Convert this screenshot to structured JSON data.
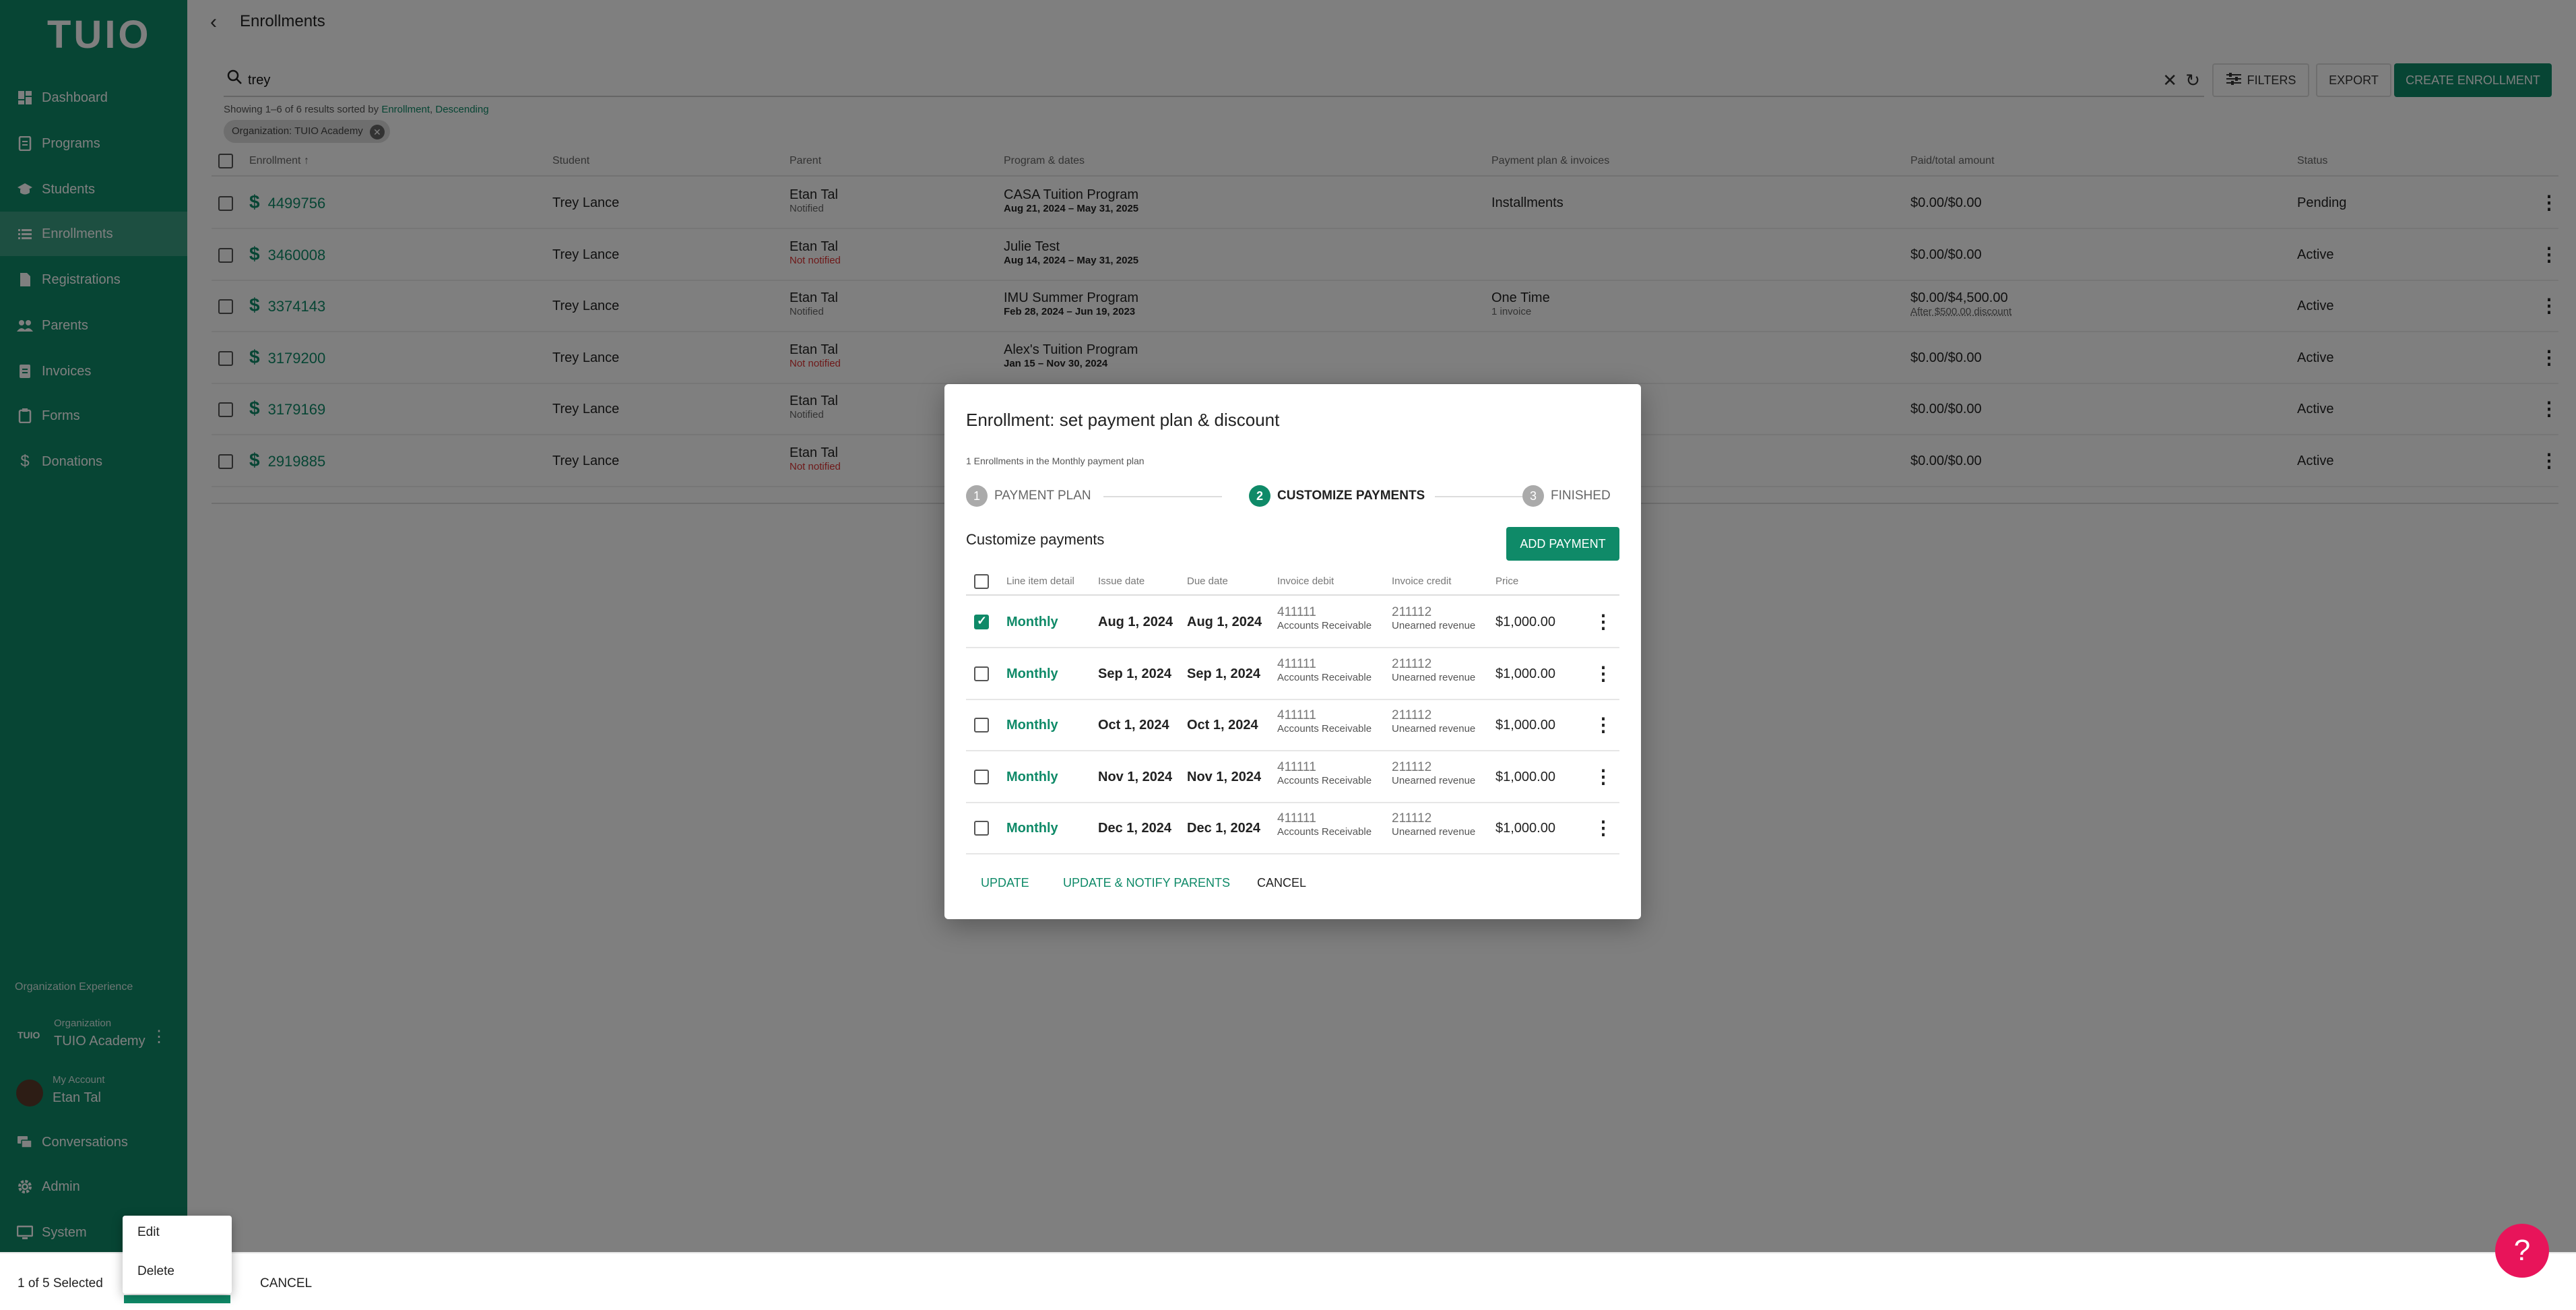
{
  "app": {
    "logo": "TUIO"
  },
  "sidebar": {
    "items": [
      {
        "label": "Dashboard",
        "icon": "dashboard-icon"
      },
      {
        "label": "Programs",
        "icon": "programs-icon"
      },
      {
        "label": "Students",
        "icon": "students-icon"
      },
      {
        "label": "Enrollments",
        "icon": "list-icon",
        "active": true
      },
      {
        "label": "Registrations",
        "icon": "registrations-icon"
      },
      {
        "label": "Parents",
        "icon": "parents-icon"
      },
      {
        "label": "Invoices",
        "icon": "invoices-icon"
      },
      {
        "label": "Forms",
        "icon": "forms-icon"
      },
      {
        "label": "Donations",
        "icon": "dollar-icon"
      }
    ],
    "org_experience": "Organization Experience",
    "org_logo": "TUIO",
    "org_caption": "Organization",
    "org_name": "TUIO Academy",
    "account_caption": "My Account",
    "account_name": "Etan Tal",
    "bottom_items": [
      {
        "label": "Conversations",
        "icon": "chat-icon"
      },
      {
        "label": "Admin",
        "icon": "gear-icon"
      },
      {
        "label": "System",
        "icon": "monitor-icon"
      }
    ]
  },
  "header": {
    "title": "Enrollments"
  },
  "search": {
    "value": "trey"
  },
  "toolbar": {
    "filters_label": "FILTERS",
    "export_label": "EXPORT",
    "create_label": "CREATE ENROLLMENT"
  },
  "results": {
    "showing_prefix": "Showing 1–6 of 6 results sorted by ",
    "sort_field": "Enrollment",
    "sort_sep": ", ",
    "sort_dir": "Descending"
  },
  "filter_chip": "Organization: TUIO Academy",
  "table": {
    "headers": [
      "Enrollment",
      "Student",
      "Parent",
      "Program & dates",
      "Payment plan & invoices",
      "Paid/total amount",
      "Status"
    ],
    "sort_arrow": "↑",
    "rows": [
      {
        "id": "4499756",
        "student": "Trey Lance",
        "parent": "Etan Tal",
        "parent_status": "Notified",
        "parent_red": false,
        "program": "CASA Tuition Program",
        "dates": "Aug 21, 2024 – May 31, 2025",
        "plan": "Installments",
        "plan_sub": "",
        "amount": "$0.00/$0.00",
        "amount_sub": "",
        "status": "Pending"
      },
      {
        "id": "3460008",
        "student": "Trey Lance",
        "parent": "Etan Tal",
        "parent_status": "Not notified",
        "parent_red": true,
        "program": "Julie Test",
        "dates": "Aug 14, 2024 – May 31, 2025",
        "plan": "",
        "plan_sub": "",
        "amount": "$0.00/$0.00",
        "amount_sub": "",
        "status": "Active"
      },
      {
        "id": "3374143",
        "student": "Trey Lance",
        "parent": "Etan Tal",
        "parent_status": "Notified",
        "parent_red": false,
        "program": "IMU Summer Program",
        "dates": "Feb 28, 2024 – Jun 19, 2023",
        "plan": "One Time",
        "plan_sub": "1 invoice",
        "amount": "$0.00/$4,500.00",
        "amount_sub": "After $500.00 discount",
        "status": "Active"
      },
      {
        "id": "3179200",
        "student": "Trey Lance",
        "parent": "Etan Tal",
        "parent_status": "Not notified",
        "parent_red": true,
        "program": "Alex's Tuition Program",
        "dates": "Jan 15 – Nov 30, 2024",
        "plan": "",
        "plan_sub": "",
        "amount": "$0.00/$0.00",
        "amount_sub": "",
        "status": "Active"
      },
      {
        "id": "3179169",
        "student": "Trey Lance",
        "parent": "Etan Tal",
        "parent_status": "Notified",
        "parent_red": false,
        "program": "",
        "dates": "",
        "plan": "",
        "plan_sub": "",
        "amount": "$0.00/$0.00",
        "amount_sub": "",
        "status": "Active"
      },
      {
        "id": "2919885",
        "student": "Trey Lance",
        "parent": "Etan Tal",
        "parent_status": "Not notified",
        "parent_red": true,
        "program": "",
        "dates": "",
        "plan": "",
        "plan_sub": "",
        "amount": "$0.00/$0.00",
        "amount_sub": "",
        "status": "Active"
      }
    ]
  },
  "dialog": {
    "title": "Enrollment: set payment plan & discount",
    "subtitle": "1 Enrollments in the Monthly payment plan",
    "steps": [
      {
        "num": "1",
        "label": "PAYMENT PLAN",
        "state": "inactive"
      },
      {
        "num": "2",
        "label": "CUSTOMIZE PAYMENTS",
        "state": "active"
      },
      {
        "num": "3",
        "label": "FINISHED",
        "state": "inactive"
      }
    ],
    "section_title": "Customize payments",
    "add_payment_label": "ADD PAYMENT",
    "headers": [
      "Line item detail",
      "Issue date",
      "Due date",
      "Invoice debit",
      "Invoice credit",
      "Price"
    ],
    "payments": [
      {
        "checked": true,
        "detail": "Monthly",
        "issue": "Aug 1, 2024",
        "due": "Aug 1, 2024",
        "debit_code": "411111",
        "debit_name": "Accounts Receivable",
        "credit_code": "211112",
        "credit_name": "Unearned revenue",
        "price": "$1,000.00"
      },
      {
        "checked": false,
        "detail": "Monthly",
        "issue": "Sep 1, 2024",
        "due": "Sep 1, 2024",
        "debit_code": "411111",
        "debit_name": "Accounts Receivable",
        "credit_code": "211112",
        "credit_name": "Unearned revenue",
        "price": "$1,000.00"
      },
      {
        "checked": false,
        "detail": "Monthly",
        "issue": "Oct 1, 2024",
        "due": "Oct 1, 2024",
        "debit_code": "411111",
        "debit_name": "Accounts Receivable",
        "credit_code": "211112",
        "credit_name": "Unearned revenue",
        "price": "$1,000.00"
      },
      {
        "checked": false,
        "detail": "Monthly",
        "issue": "Nov 1, 2024",
        "due": "Nov 1, 2024",
        "debit_code": "411111",
        "debit_name": "Accounts Receivable",
        "credit_code": "211112",
        "credit_name": "Unearned revenue",
        "price": "$1,000.00"
      },
      {
        "checked": false,
        "detail": "Monthly",
        "issue": "Dec 1, 2024",
        "due": "Dec 1, 2024",
        "debit_code": "411111",
        "debit_name": "Accounts Receivable",
        "credit_code": "211112",
        "credit_name": "Unearned revenue",
        "price": "$1,000.00"
      }
    ],
    "update_label": "UPDATE",
    "update_notify_label": "UPDATE & NOTIFY PARENTS",
    "cancel_label": "CANCEL"
  },
  "bottombar": {
    "selected_text": "1 of 5 Selected",
    "cancel_label": "CANCEL"
  },
  "popmenu": {
    "edit_label": "Edit",
    "delete_label": "Delete"
  },
  "help": {
    "icon": "help-icon",
    "glyph": "?"
  },
  "colors": {
    "brand": "#0f8a68",
    "help": "#e8145a",
    "danger": "#dd3333"
  }
}
